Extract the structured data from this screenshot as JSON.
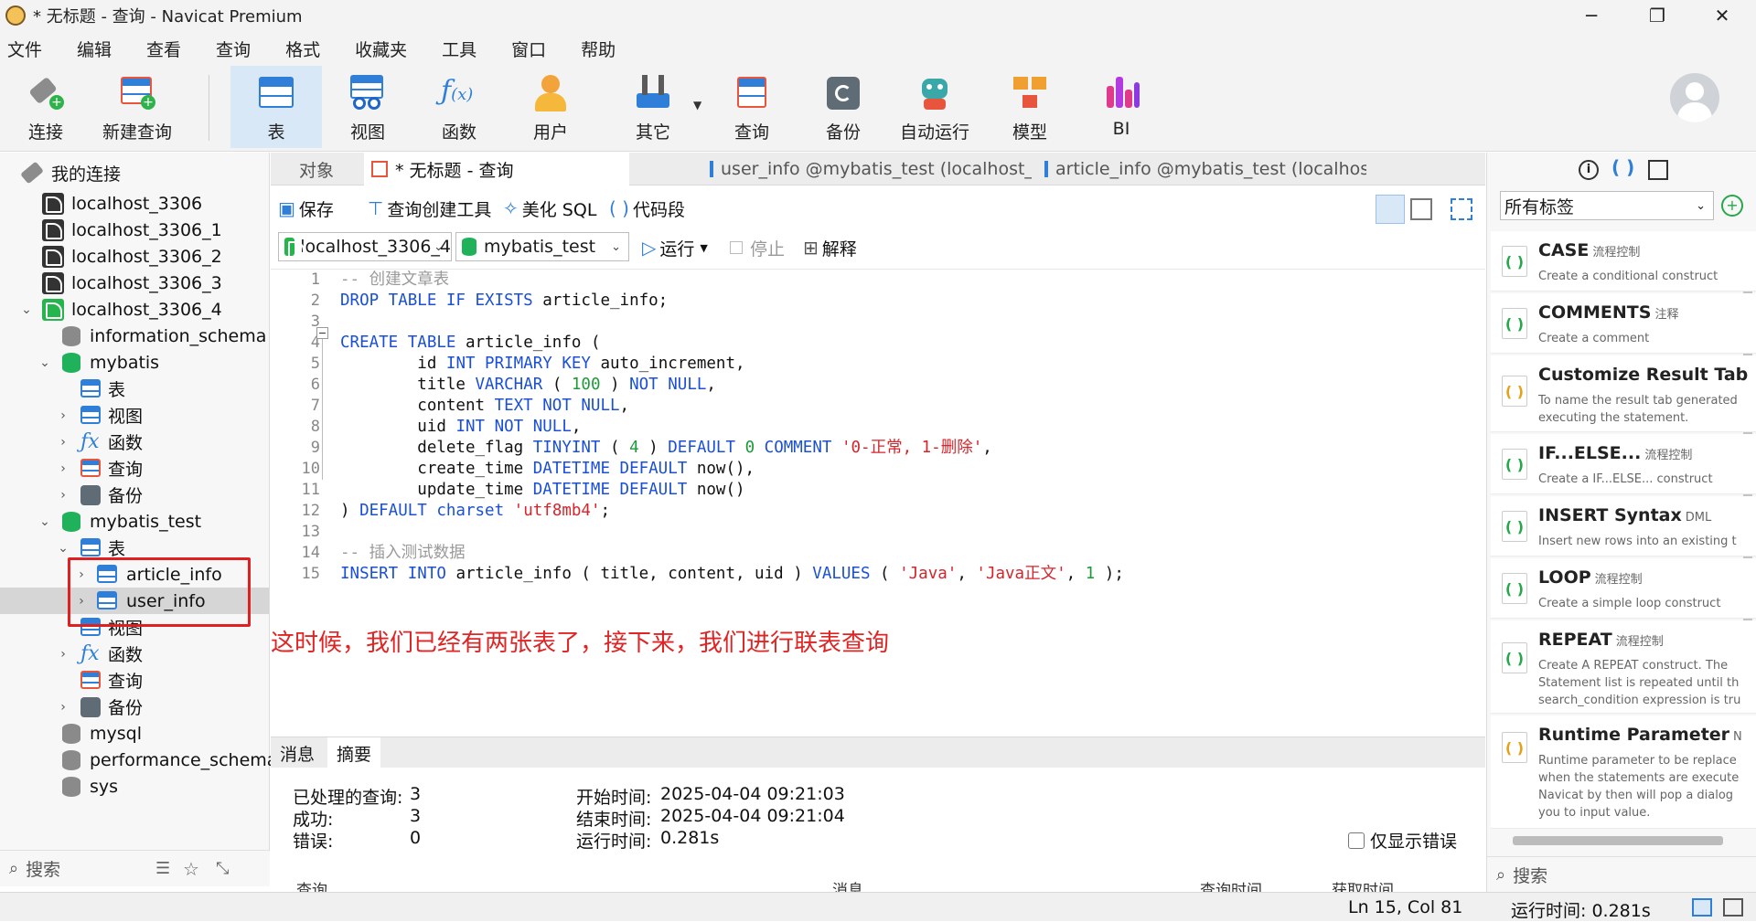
{
  "window": {
    "title": "* 无标题 - 查询 - Navicat Premium",
    "minimize": "─",
    "maximize": "❐",
    "close": "✕"
  },
  "menu": [
    "文件",
    "编辑",
    "查看",
    "查询",
    "格式",
    "收藏夹",
    "工具",
    "窗口",
    "帮助"
  ],
  "toolbar": {
    "connect": "连接",
    "new_query": "新建查询",
    "table": "表",
    "view": "视图",
    "function": "函数",
    "user": "用户",
    "other": "其它",
    "query": "查询",
    "backup": "备份",
    "autorun": "自动运行",
    "model": "模型",
    "bi": "BI"
  },
  "sidebar": {
    "header": "我的连接",
    "search_placeholder": "搜索",
    "tree": [
      "localhost_3306",
      "localhost_3306_1",
      "localhost_3306_2",
      "localhost_3306_3",
      "localhost_3306_4",
      "information_schema",
      "mybatis",
      "表",
      "视图",
      "函数",
      "查询",
      "备份",
      "mybatis_test",
      "表",
      "article_info",
      "user_info",
      "视图",
      "函数",
      "查询",
      "备份",
      "mysql",
      "performance_schema",
      "sys"
    ]
  },
  "tabs": {
    "objects": "对象",
    "query": "* 无标题 - 查询",
    "user_info": "user_info @mybatis_test (localhost_...",
    "article_info": "article_info @mybatis_test (localhos..."
  },
  "editor_toolbar": {
    "save": "保存",
    "query_builder": "查询创建工具",
    "beautify": "美化 SQL",
    "snippet": "代码段",
    "connection": "localhost_3306_4",
    "database": "mybatis_test",
    "run": "运行",
    "stop": "停止",
    "explain": "解释"
  },
  "code": {
    "line_numbers": [
      "1",
      "2",
      "3",
      "4",
      "5",
      "6",
      "7",
      "8",
      "9",
      "10",
      "11",
      "12",
      "13",
      "14",
      "15"
    ],
    "l1": "-- 创建文章表",
    "l2a": "DROP TABLE IF EXISTS",
    "l2b": " article_info;",
    "l4a": "CREATE TABLE",
    "l4b": " article_info (",
    "l5a": "        id ",
    "l5b": "INT PRIMARY KEY",
    "l5c": " auto_increment,",
    "l6a": "        title ",
    "l6b": "VARCHAR",
    "l6c": " ( ",
    "l6d": "100",
    "l6e": " ) ",
    "l6f": "NOT NULL",
    "l6g": ",",
    "l7a": "        content ",
    "l7b": "TEXT NOT NULL",
    "l7c": ",",
    "l8a": "        uid ",
    "l8b": "INT NOT NULL",
    "l8c": ",",
    "l9a": "        delete_flag ",
    "l9b": "TINYINT",
    "l9c": " ( ",
    "l9d": "4",
    "l9e": " ) ",
    "l9f": "DEFAULT",
    "l9g": " ",
    "l9h": "0",
    "l9i": " ",
    "l9j": "COMMENT",
    "l9k": " ",
    "l9l": "'0-正常, 1-删除'",
    "l9m": ",",
    "l10a": "        create_time ",
    "l10b": "DATETIME DEFAULT",
    "l10c": " now(),",
    "l11a": "        update_time ",
    "l11b": "DATETIME DEFAULT",
    "l11c": " now()",
    "l12a": ") ",
    "l12b": "DEFAULT charset",
    "l12c": " ",
    "l12d": "'utf8mb4'",
    "l12e": ";",
    "l14": "-- 插入测试数据",
    "l15a": "INSERT INTO",
    "l15b": " article_info ( title, content, uid ) ",
    "l15c": "VALUES",
    "l15d": " ( ",
    "l15e": "'Java'",
    "l15f": ", ",
    "l15g": "'Java正文'",
    "l15h": ", ",
    "l15i": "1",
    "l15j": " );"
  },
  "annotation": "这时候，我们已经有两张表了，接下来，我们进行联表查询",
  "results": {
    "tab_messages": "消息",
    "tab_summary": "摘要",
    "processed_label": "已处理的查询:",
    "processed_value": "3",
    "success_label": "成功:",
    "success_value": "3",
    "error_label": "错误:",
    "error_value": "0",
    "start_label": "开始时间:",
    "start_value": "2025-04-04 09:21:03",
    "end_label": "结束时间:",
    "end_value": "2025-04-04 09:21:04",
    "elapsed_label": "运行时间:",
    "elapsed_value": "0.281s",
    "only_errors": "仅显示错误",
    "col_query": "查询",
    "col_message": "消息",
    "col_query_time": "查询时间",
    "col_fetch_time": "获取时间"
  },
  "status": {
    "cursor": "Ln 15, Col 81",
    "elapsed": "运行时间: 0.281s"
  },
  "right_panel": {
    "tag_filter": "所有标签",
    "search_placeholder": "搜索",
    "snippets": [
      {
        "title": "CASE",
        "tag": "流程控制",
        "desc": "Create a conditional construct"
      },
      {
        "title": "COMMENTS",
        "tag": "注释",
        "desc": "Create a comment"
      },
      {
        "title": "Customize Result Tab",
        "tag": "",
        "desc": "To name the result tab generated executing the statement."
      },
      {
        "title": "IF...ELSE...",
        "tag": "流程控制",
        "desc": "Create a IF...ELSE... construct"
      },
      {
        "title": "INSERT Syntax",
        "tag": "DML",
        "desc": "Insert new rows into an existing t"
      },
      {
        "title": "LOOP",
        "tag": "流程控制",
        "desc": "Create a simple loop construct"
      },
      {
        "title": "REPEAT",
        "tag": "流程控制",
        "desc": "Create A REPEAT construct. The Statement list is repeated until th search_condition expression is tru"
      },
      {
        "title": "Runtime Parameter",
        "tag": "N",
        "desc": "Runtime parameter to be replace when the statements are execute Navicat by then will pop a dialog you to input value."
      }
    ]
  }
}
